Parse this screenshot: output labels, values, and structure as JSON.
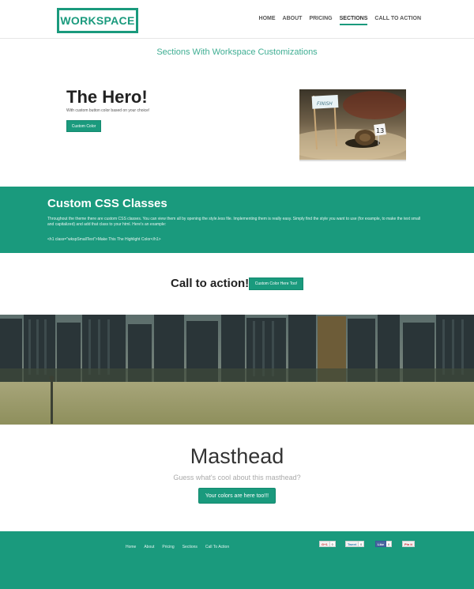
{
  "header": {
    "logo": "WORKSPACE",
    "nav": [
      "HOME",
      "ABOUT",
      "PRICING",
      "SECTIONS",
      "CALL TO ACTION"
    ],
    "active_index": 3
  },
  "subtitle": "Sections With Workspace Customizations",
  "hero": {
    "title": "The Hero!",
    "subtitle": "With custom button color based on your choice!",
    "button": "Custom Color",
    "image": {
      "flag_text": "FINISH",
      "tag_number": "13"
    }
  },
  "css_section": {
    "title": "Custom CSS Classes",
    "text": "Throughout the theme there are custom CSS classes. You can view them all by opening the style.less file. Implementing them is really easy. Simply find the style you want to use (for example, to make the text small and capitalized) and add that class to your html. Here's an example:",
    "code": "<h1 class=\"wkspSmallText\">Make This The Highlight Color</h1>"
  },
  "cta": {
    "title": "Call to action!",
    "button": "Custom Color Here Too!"
  },
  "masthead": {
    "title": "Masthead",
    "subtitle": "Guess what's cool about this masthead?",
    "button": "Your colors are here too!!!"
  },
  "footer": {
    "nav": [
      "Home",
      "About",
      "Pricing",
      "Sections",
      "Call To Action"
    ],
    "social": [
      {
        "label": "G+1",
        "count": "0"
      },
      {
        "label": "Tweet",
        "count": "0"
      },
      {
        "label": "Like",
        "count": "0"
      },
      {
        "label": "Pin it",
        "count": ""
      }
    ]
  },
  "colors": {
    "accent": "#1a9a7d",
    "text": "#222222"
  }
}
